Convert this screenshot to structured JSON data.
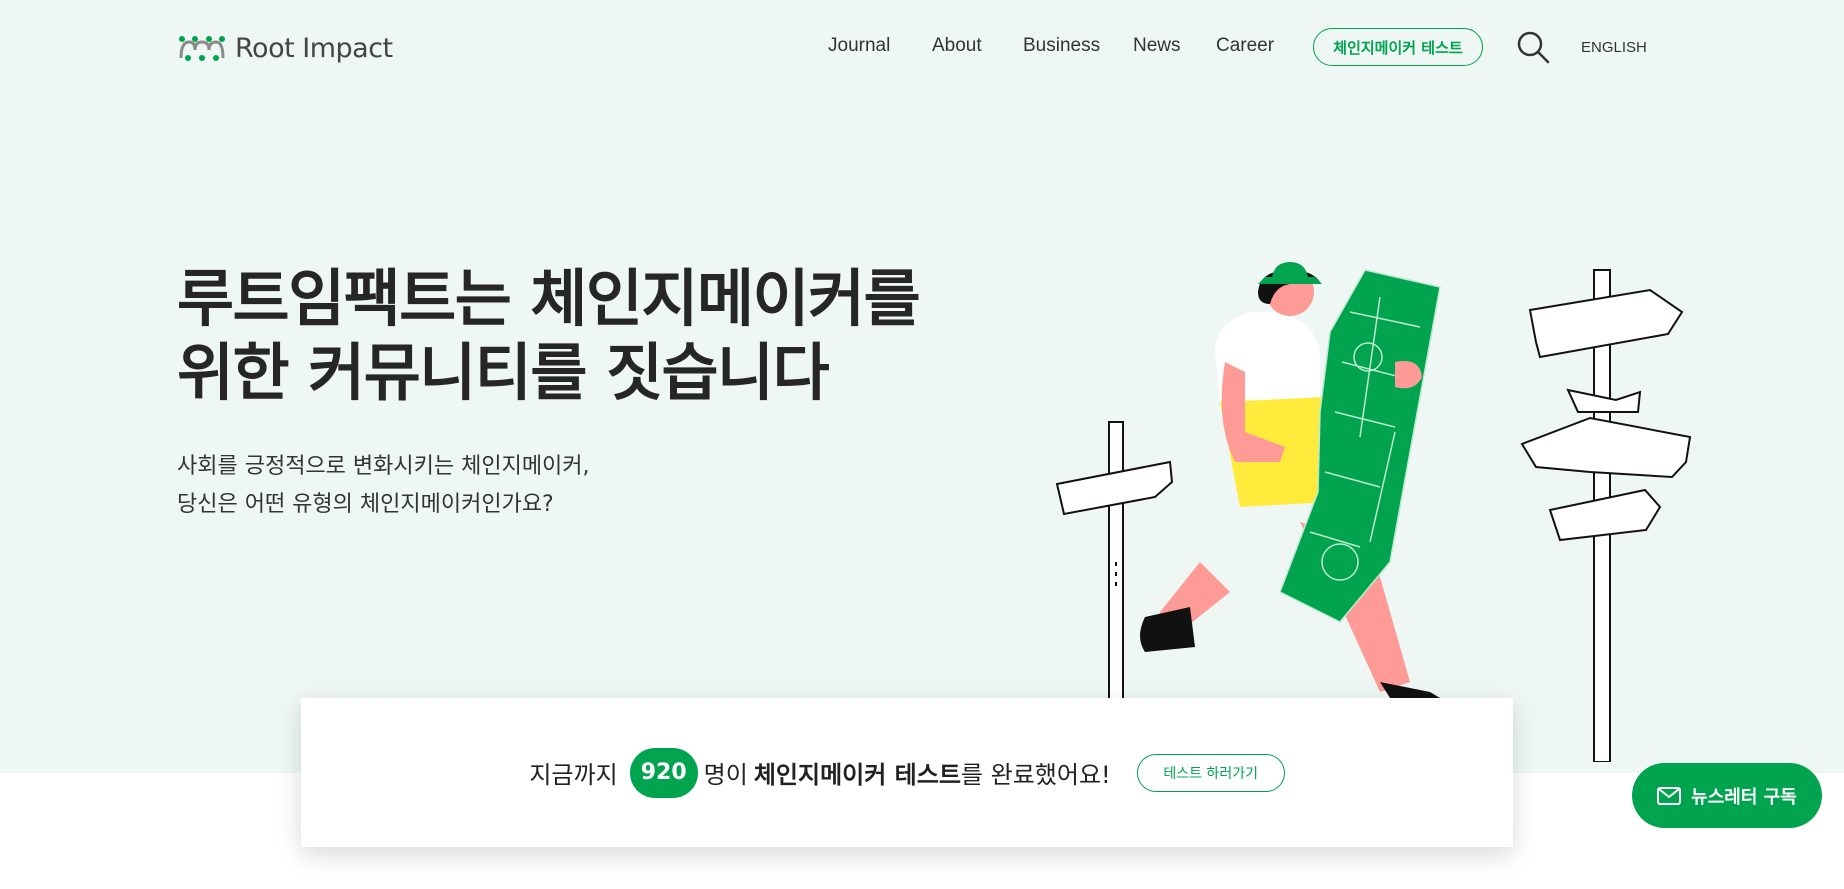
{
  "header": {
    "logo_text": "Root Impact",
    "nav": [
      {
        "label": "Journal"
      },
      {
        "label": "About"
      },
      {
        "label": "Business"
      },
      {
        "label": "News"
      },
      {
        "label": "Career"
      }
    ],
    "cta_label": "체인지메이커 테스트",
    "search_icon": "search-icon",
    "language_label": "ENGLISH"
  },
  "hero": {
    "headline_line1": "루트임팩트는 체인지메이커를",
    "headline_line2": "위한 커뮤니티를 짓습니다",
    "sub_line1": "사회를 긍정적으로 변화시키는 체인지메이커,",
    "sub_line2": "당신은 어떤 유형의 체인지메이커인가요?"
  },
  "counter": {
    "prefix": "지금까지",
    "count": "920",
    "middle": "명이",
    "bold_text": "체인지메이커 테스트",
    "suffix": "를 완료했어요!",
    "button_label": "테스트 하러가기"
  },
  "newsletter": {
    "label": "뉴스레터 구독",
    "icon": "mail-icon"
  },
  "colors": {
    "accent": "#00a44f",
    "hero_background": "#eef7f3",
    "skin": "#ff9b96",
    "shirt_yellow": "#ffeb3b"
  }
}
